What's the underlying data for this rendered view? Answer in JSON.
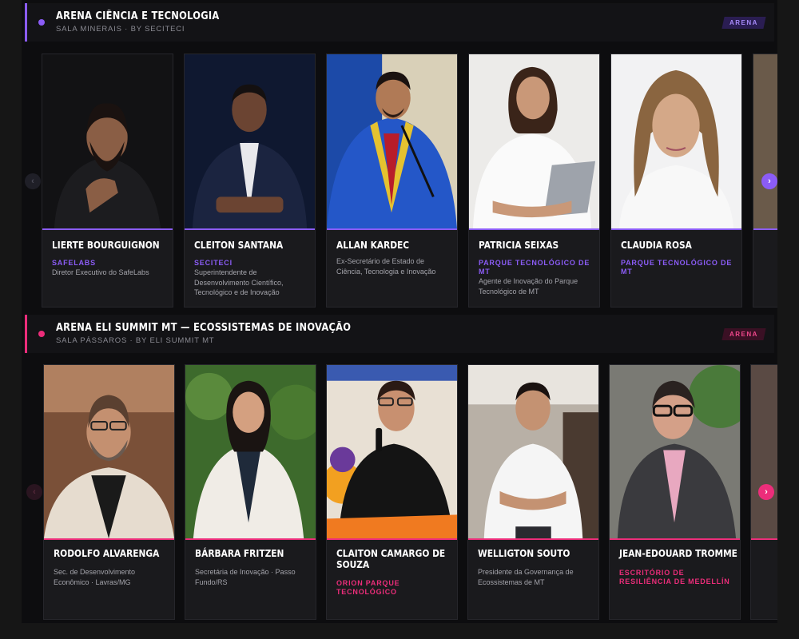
{
  "sections": [
    {
      "title": "ARENA CIÊNCIA E TECNOLOGIA",
      "subtitle": "SALA MINERAIS · BY SECITECI",
      "badge": "ARENA",
      "accent": "#8b5cf6",
      "nav": {
        "prev": "‹",
        "next": "›"
      },
      "speakers": [
        {
          "name": "LIERTE BOURGUIGNON",
          "org": "SAFELABS",
          "role": "Diretor Executivo do SafeLabs"
        },
        {
          "name": "CLEITON SANTANA",
          "org": "SECITECI",
          "role": "Superintendente de Desenvolvimento Científico, Tecnológico e de Inovação"
        },
        {
          "name": "ALLAN KARDEC",
          "org": "",
          "role": "Ex-Secretário de Estado de Ciência, Tecnologia e Inovação"
        },
        {
          "name": "PATRICIA SEIXAS",
          "org": "PARQUE TECNOLÓGICO DE MT",
          "role": "Agente de Inovação do Parque Tecnológico de MT"
        },
        {
          "name": "CLAUDIA ROSA",
          "org": "PARQUE TECNOLÓGICO DE MT",
          "role": ""
        }
      ]
    },
    {
      "title": "ARENA ELI SUMMIT MT — ECOSSISTEMAS DE INOVAÇÃO",
      "subtitle": "SALA PÁSSAROS · BY ELI SUMMIT MT",
      "badge": "ARENA",
      "accent": "#ec2d7a",
      "nav": {
        "prev": "‹",
        "next": "›"
      },
      "speakers": [
        {
          "name": "RODOLFO ALVARENGA",
          "org": "",
          "role": "Sec. de Desenvolvimento Econômico · Lavras/MG"
        },
        {
          "name": "BÁRBARA FRITZEN",
          "org": "",
          "role": "Secretária de Inovação · Passo Fundo/RS"
        },
        {
          "name": "CLAITON CAMARGO DE SOUZA",
          "org": "ORION PARQUE TECNOLÓGICO",
          "role": ""
        },
        {
          "name": "WELLIGTON SOUTO",
          "org": "",
          "role": "Presidente da Governança de Ecossistemas de MT"
        },
        {
          "name": "JEAN-EDOUARD TROMME",
          "org": "ESCRITÓRIO DE RESILIÊNCIA DE MEDELLÍN",
          "role": ""
        }
      ]
    }
  ]
}
